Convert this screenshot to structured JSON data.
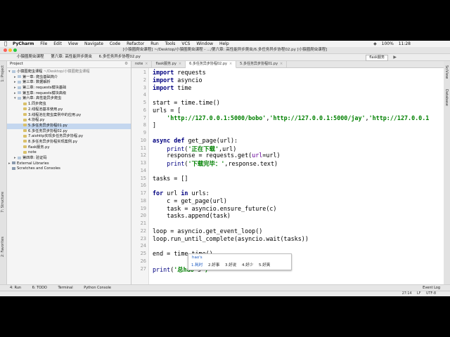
{
  "menubar": {
    "app_name": "PyCharm",
    "items": [
      "File",
      "Edit",
      "View",
      "Navigate",
      "Code",
      "Refactor",
      "Run",
      "Tools",
      "VCS",
      "Window",
      "Help"
    ],
    "time": "11:28",
    "battery": "100%"
  },
  "ime_badge": "中文",
  "window_title": "[小猿圈爬虫课程] ~/Desktop/小猿圈爬虫课程 - .../第六章: 高性能异步爬虫/6.多任务异步协程02.py [小猿圈爬虫课程]",
  "navbar": {
    "crumbs": [
      "小猿圈爬虫课程",
      "第六章: 高性能异步爬虫",
      "6.多任务异步协程02.py"
    ],
    "run_config": "flask服务"
  },
  "left_stripe": {
    "project": "1: Project",
    "structure": "7: Structure",
    "favorites": "2: Favorites"
  },
  "right_stripe": {
    "scview": "SciView",
    "database": "Database"
  },
  "project_panel": {
    "title": "Project",
    "root": "小猿圈爬虫课程",
    "root_path": "~/Desktop/小猿圈爬虫课程",
    "items": [
      "第一章: 爬虫基础简介",
      "第三章: 数据解析",
      "第二章: requests模块基础",
      "第五章: requests模块高级",
      "第六章: 高性能异步爬虫",
      "1.同步爬虫",
      "2.线程池基本使用.py",
      "3.线程池在爬虫案例中的应用.py",
      "4.协程.py",
      "5.多任务异步协程01.py",
      "6.多任务异步协程02.py",
      "7.aiohttp实现多任务异步协程.py",
      "8.多任务异步协程实现案例.py",
      "flask服务.py",
      "note",
      "第四章: 验证码",
      "External Libraries",
      "Scratches and Consoles"
    ]
  },
  "tabs": [
    "note",
    "flask服务.py",
    "6.多任务异步协程02.py",
    "5.多任务异步协程01.py"
  ],
  "active_tab": "6.多任务异步协程02.py",
  "editor": {
    "line_numbers": [
      "1",
      "2",
      "3",
      "4",
      "5",
      "6",
      "7",
      "8",
      "9",
      "10",
      "11",
      "12",
      "13",
      "14",
      "15",
      "16",
      "17",
      "18",
      "19",
      "20",
      "21",
      "22",
      "23",
      "24",
      "25",
      "26",
      "27"
    ],
    "code": [
      "import requests",
      "import asyncio",
      "import time",
      "",
      "start = time.time()",
      "urls = [",
      "    'http://127.0.0.1:5000/bobo','http://127.0.0.1:5000/jay','http://127.0.0.1",
      "]",
      "",
      "async def get_page(url):",
      "    print('正在下载',url)",
      "    response = requests.get(url=url)",
      "    print('下载完毕：',response.text)",
      "",
      "tasks = []",
      "",
      "for url in urls:",
      "    c = get_page(url)",
      "    task = asyncio.ensure_future(c)",
      "    tasks.append(task)",
      "",
      "loop = asyncio.get_event_loop()",
      "loop.run_until_complete(asyncio.wait(tasks))",
      "",
      "end = time.time()",
      "",
      "print('总hao's')"
    ]
  },
  "ime_popup": {
    "pinyin": "hao's",
    "candidates": [
      "1.耗时",
      "2.好事",
      "3.好说",
      "4.好少",
      "5.好爽"
    ]
  },
  "bottom_tools": [
    "4: Run",
    "6: TODO",
    "Terminal",
    "Python Console"
  ],
  "event_log": "Event Log",
  "status": {
    "position": "27:14",
    "line_sep": "LF",
    "encoding": "UTF-8"
  }
}
